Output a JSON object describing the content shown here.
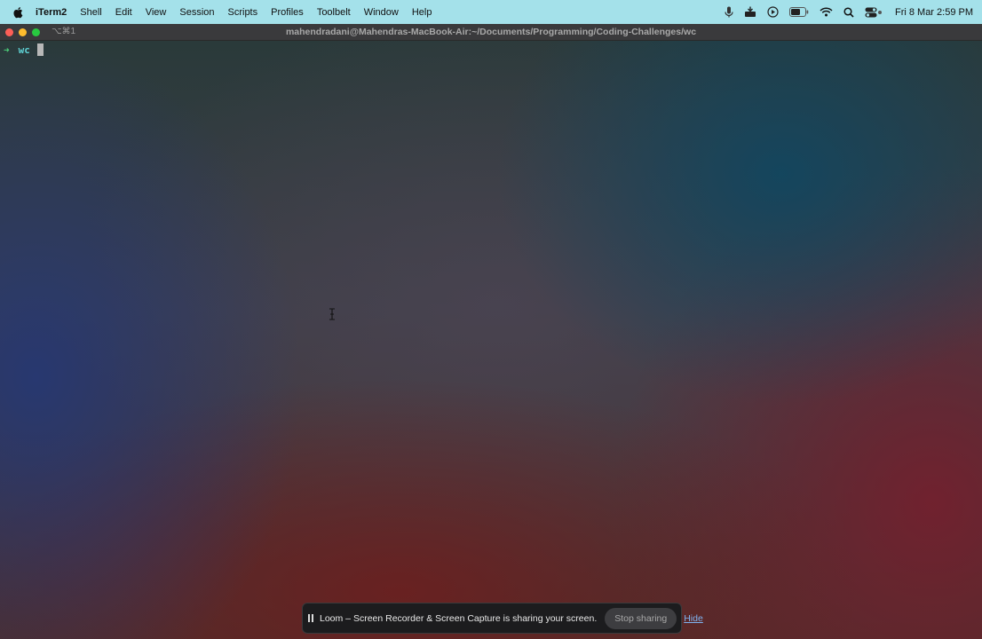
{
  "menubar": {
    "app_name": "iTerm2",
    "items": [
      "Shell",
      "Edit",
      "View",
      "Session",
      "Scripts",
      "Profiles",
      "Toolbelt",
      "Window",
      "Help"
    ],
    "clock": "Fri 8 Mar  2:59 PM",
    "status_icons": [
      "microphone-icon",
      "drive-icon",
      "play-circle-icon",
      "battery-icon",
      "wifi-icon",
      "search-icon",
      "control-center-icon"
    ]
  },
  "window": {
    "tab_shortcut": "⌥⌘1",
    "title": "mahendradani@Mahendras-MacBook-Air:~/Documents/Programming/Coding-Challenges/wc"
  },
  "terminal": {
    "prompt_symbol": "➜",
    "command": "wc"
  },
  "loom": {
    "message": "Loom – Screen Recorder & Screen Capture is sharing your screen.",
    "stop_label": "Stop sharing",
    "hide_label": "Hide"
  },
  "colors": {
    "menubar_bg": "#a4e1ea",
    "prompt_arrow": "#4cd07a",
    "command_text": "#5fd3d6",
    "close": "#fe5f57",
    "minimize": "#febc2e",
    "maximize": "#28c840"
  }
}
